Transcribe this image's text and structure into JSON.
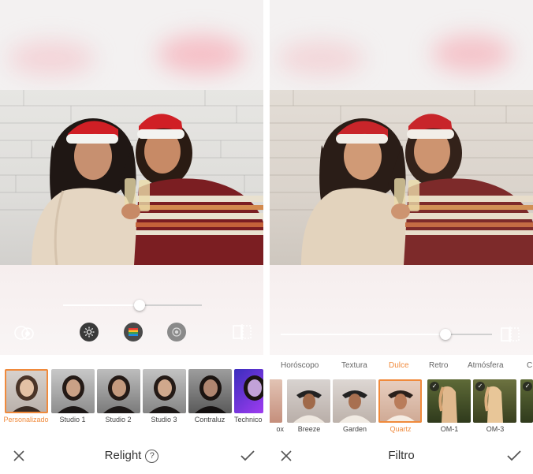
{
  "colors": {
    "accent": "#f08a3c",
    "text": "#333333",
    "icon": "#555555"
  },
  "left_screen": {
    "relight_thumbs": [
      {
        "label": "Personalizado",
        "selected": true
      },
      {
        "label": "Studio 1",
        "selected": false
      },
      {
        "label": "Studio 2",
        "selected": false
      },
      {
        "label": "Studio 3",
        "selected": false
      },
      {
        "label": "Contraluz",
        "selected": false
      },
      {
        "label": "Technico",
        "selected": false
      }
    ],
    "slider_value": 0.55,
    "tool_icons": [
      "face-select-icon",
      "brightness-icon",
      "color-icon",
      "shadow-icon",
      "compare-icon"
    ],
    "title": "Relight",
    "help_symbol": "?",
    "cancel_icon": "close-icon",
    "confirm_icon": "check-icon"
  },
  "right_screen": {
    "categories": [
      {
        "label": "Horóscopo",
        "active": false
      },
      {
        "label": "Textura",
        "active": false
      },
      {
        "label": "Dulce",
        "active": true
      },
      {
        "label": "Retro",
        "active": false
      },
      {
        "label": "Atmósfera",
        "active": false
      },
      {
        "label": "C",
        "active": false
      }
    ],
    "filters": [
      {
        "label": "ox",
        "selected": false,
        "checked": false
      },
      {
        "label": "Breeze",
        "selected": false,
        "checked": false
      },
      {
        "label": "Garden",
        "selected": false,
        "checked": false
      },
      {
        "label": "Quartz",
        "selected": true,
        "checked": false
      },
      {
        "label": "OM-1",
        "selected": false,
        "checked": true
      },
      {
        "label": "OM-3",
        "selected": false,
        "checked": true
      },
      {
        "label": "",
        "selected": false,
        "checked": false
      }
    ],
    "slider_value": 0.78,
    "title": "Filtro",
    "cancel_icon": "close-icon",
    "confirm_icon": "check-icon"
  }
}
